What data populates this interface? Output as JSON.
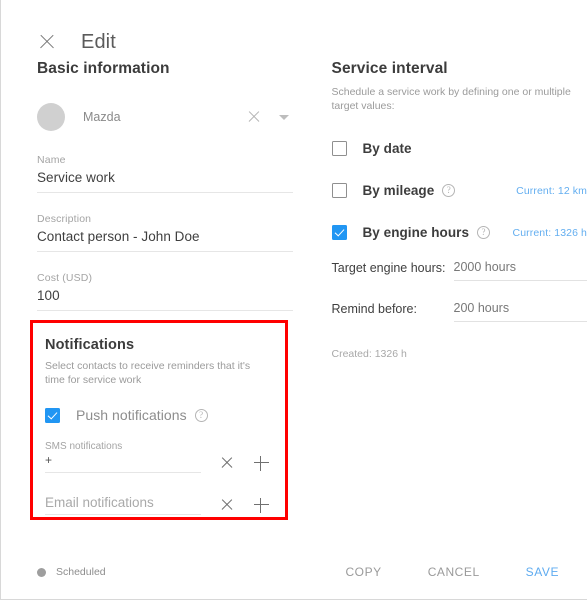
{
  "header": {
    "title": "Edit",
    "close_icon": "close-icon"
  },
  "basic_information": {
    "title": "Basic information",
    "entity": {
      "name": "Mazda",
      "clear_icon": "close-icon",
      "dropdown_icon": "chevron-down-icon"
    },
    "fields": [
      {
        "label": "Name",
        "value": "Service work"
      },
      {
        "label": "Description",
        "value": "Contact person - John Doe"
      },
      {
        "label": "Cost (USD)",
        "value": "100"
      }
    ]
  },
  "notifications": {
    "title": "Notifications",
    "subtitle": "Select contacts to receive reminders that it's time for service work",
    "push": {
      "label": "Push notifications",
      "checked": true,
      "help_icon": "help-icon",
      "help_glyph": "?"
    },
    "sms": {
      "label": "SMS notifications",
      "value": "+",
      "clear_icon": "close-icon",
      "add_icon": "plus-icon"
    },
    "email": {
      "placeholder": "Email notifications",
      "value": "",
      "clear_icon": "close-icon",
      "add_icon": "plus-icon"
    },
    "highlight_color": "#ff0000"
  },
  "service_interval": {
    "title": "Service interval",
    "subtitle": "Schedule a service work by defining one or multiple target values:",
    "by_date": {
      "label": "By date",
      "checked": false
    },
    "by_mileage": {
      "label": "By mileage",
      "checked": false,
      "help_glyph": "?",
      "current": "Current: 12 km"
    },
    "by_engine_hours": {
      "label": "By engine hours",
      "checked": true,
      "help_glyph": "?",
      "current": "Current: 1326 h",
      "target_label": "Target engine hours:",
      "target_value": "2000 hours",
      "remind_label": "Remind before:",
      "remind_value": "200 hours"
    },
    "created": "Created: 1326 h"
  },
  "footer": {
    "status": "Scheduled",
    "status_color": "#9e9e9e",
    "copy_label": "COPY",
    "cancel_label": "CANCEL",
    "save_label": "SAVE",
    "save_color": "#5eabf0"
  }
}
